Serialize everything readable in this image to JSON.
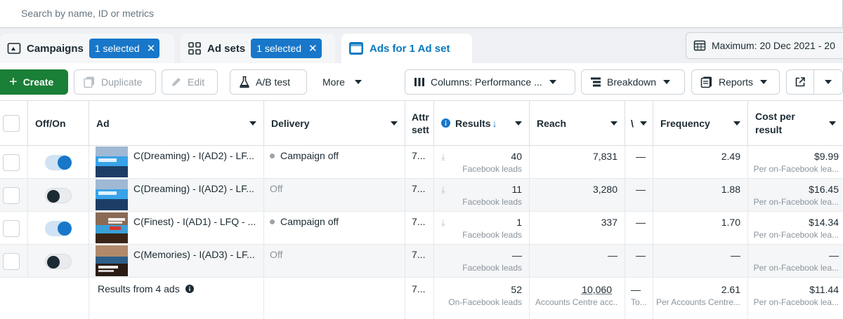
{
  "search": {
    "placeholder": "Search by name, ID or metrics"
  },
  "tabs": {
    "campaigns": {
      "label": "Campaigns",
      "pill": "1 selected"
    },
    "adsets": {
      "label": "Ad sets",
      "pill": "1 selected"
    },
    "ads": {
      "label": "Ads for 1 Ad set"
    }
  },
  "daterange": {
    "label": "Maximum: 20 Dec 2021 - 20"
  },
  "toolbar": {
    "create": "Create",
    "duplicate": "Duplicate",
    "edit": "Edit",
    "abtest": "A/B test",
    "more": "More",
    "columns": "Columns: Performance ...",
    "breakdown": "Breakdown",
    "reports": "Reports"
  },
  "columns": {
    "offon": "Off/On",
    "ad": "Ad",
    "delivery": "Delivery",
    "attribution": "Attr sett",
    "results": "Results",
    "reach": "Reach",
    "impressions_short": "\\",
    "frequency": "Frequency",
    "cost_per_result": "Cost per result"
  },
  "rows": [
    {
      "toggle": "on",
      "name": "C(Dreaming) - I(AD2) - LF...",
      "delivery": "Campaign off",
      "delivery_state": "dot",
      "attribution": "7...",
      "results": "40",
      "results_sub": "Facebook leads",
      "reach": "7,831",
      "impr": "—",
      "frequency": "2.49",
      "cost": "$9.99",
      "cost_sub": "Per on-Facebook lea..."
    },
    {
      "toggle": "off",
      "name": "C(Dreaming) - I(AD2) - LF...",
      "delivery": "Off",
      "delivery_state": "off",
      "attribution": "7...",
      "results": "11",
      "results_sub": "Facebook leads",
      "reach": "3,280",
      "impr": "—",
      "frequency": "1.88",
      "cost": "$16.45",
      "cost_sub": "Per on-Facebook lea..."
    },
    {
      "toggle": "on",
      "name": "C(Finest) - I(AD1) - LFQ - ...",
      "delivery": "Campaign off",
      "delivery_state": "dot",
      "attribution": "7...",
      "results": "1",
      "results_sub": "Facebook leads",
      "reach": "337",
      "impr": "—",
      "frequency": "1.70",
      "cost": "$14.34",
      "cost_sub": "Per on-Facebook lea..."
    },
    {
      "toggle": "off",
      "name": "C(Memories) - I(AD3) - LF...",
      "delivery": "Off",
      "delivery_state": "off",
      "attribution": "7...",
      "results": "—",
      "results_sub": "Facebook leads",
      "reach": "—",
      "impr": "—",
      "frequency": "—",
      "cost": "—",
      "cost_sub": "Per on-Facebook lea..."
    }
  ],
  "summary": {
    "label": "Results from 4 ads",
    "attribution": "7...",
    "results": "52",
    "results_sub": "On-Facebook leads",
    "reach": "10,060",
    "reach_sub": "Accounts Centre acc...",
    "impr": "—",
    "impr_sub": "To...",
    "frequency": "2.61",
    "frequency_sub": "Per Accounts Centre...",
    "cost": "$11.44",
    "cost_sub": "Per on-Facebook lea..."
  },
  "colors": {
    "accent": "#1877c9",
    "create_green": "#1a7f37",
    "tab_active_text": "#0a78be"
  }
}
